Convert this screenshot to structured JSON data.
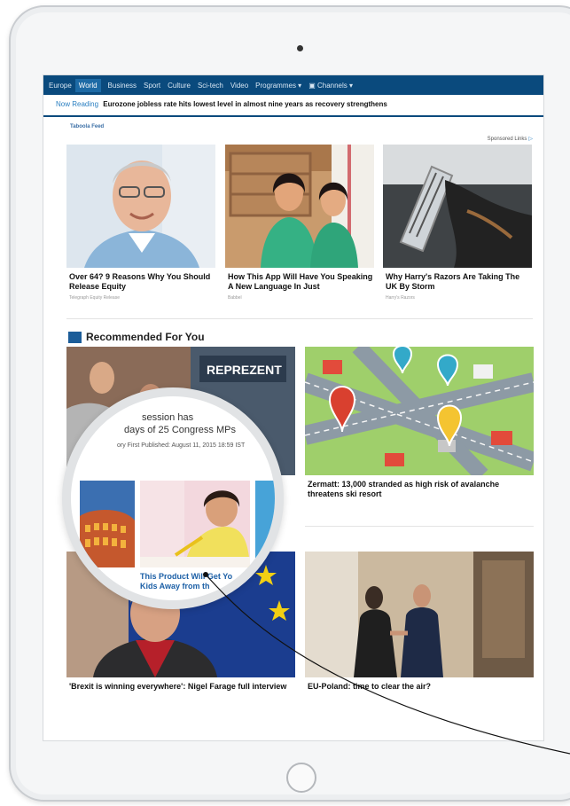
{
  "nav": {
    "items": [
      "Europe",
      "World",
      "Business",
      "Sport",
      "Culture",
      "Sci-tech",
      "Video",
      "Programmes ▾",
      "▣ Channels ▾"
    ],
    "active": "World"
  },
  "now_reading": {
    "label": "Now Reading",
    "title": "Eurozone jobless rate hits lowest level in almost nine years as recovery strengthens"
  },
  "feed": {
    "logo": "Taboola Feed",
    "sponsored": "Sponsored Links",
    "cards": [
      {
        "headline": "Over 64? 9 Reasons Why You Should Release Equity",
        "source": "Telegraph Equity Release"
      },
      {
        "headline": "How This App Will Have You Speaking A New Language In Just",
        "source": "Babbel"
      },
      {
        "headline": "Why Harry's Razors Are Taking The UK By Storm",
        "source": "Harry's Razors"
      }
    ]
  },
  "recommended": {
    "title": "Recommended For You",
    "banner_text": "REPREZENT",
    "cards": [
      {
        "headline": "Zermatt: 13,000 stranded as high risk of avalanche threatens ski resort"
      },
      {
        "headline": "'Brexit is winning everywhere': Nigel Farage full interview"
      },
      {
        "headline": "EU-Poland: time to clear the air?"
      }
    ]
  },
  "magnifier": {
    "line1": "session has",
    "line2": "days of 25 Congress MPs",
    "meta": "ory First Published: August 11, 2015 18:59 IST",
    "headline_line1": "This Product Will Get Yo",
    "headline_line2": "Kids Away from th"
  }
}
